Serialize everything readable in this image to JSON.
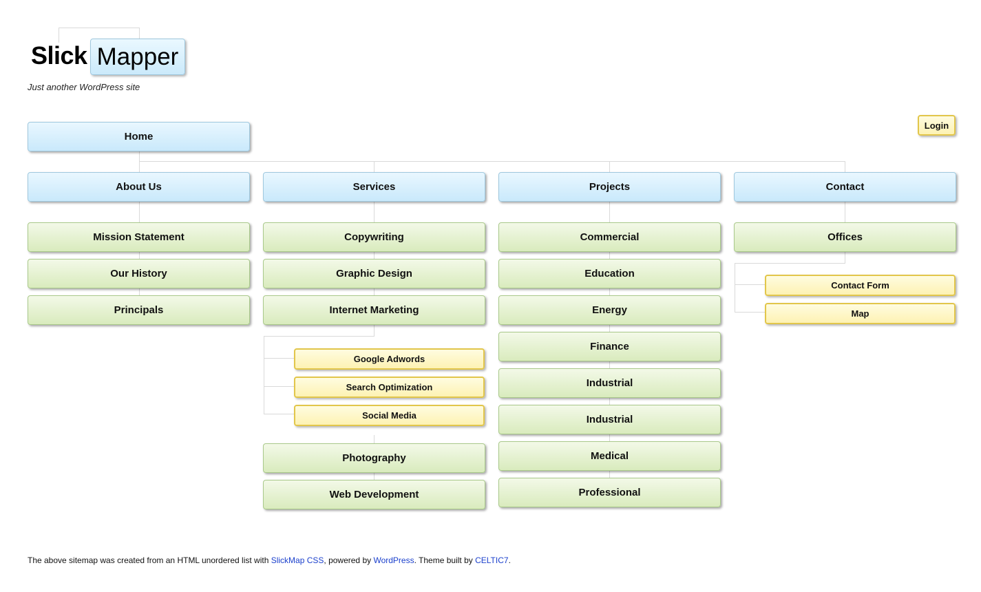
{
  "site": {
    "logo_word1": "Slick",
    "logo_word2": "Mapper",
    "tagline": "Just another WordPress site"
  },
  "utility": {
    "login_label": "Login"
  },
  "sitemap": {
    "home": "Home",
    "sections": [
      {
        "label": "About Us",
        "children": [
          "Mission Statement",
          "Our History",
          "Principals"
        ]
      },
      {
        "label": "Services",
        "children": [
          "Copywriting",
          "Graphic Design",
          "Internet Marketing",
          "Photography",
          "Web Development"
        ],
        "sub": {
          "parent": "Internet Marketing",
          "items": [
            "Google Adwords",
            "Search Optimization",
            "Social Media"
          ]
        }
      },
      {
        "label": "Projects",
        "children": [
          "Commercial",
          "Education",
          "Energy",
          "Finance",
          "Industrial",
          "Industrial",
          "Medical",
          "Professional"
        ]
      },
      {
        "label": "Contact",
        "children": [
          "Offices"
        ],
        "sub": {
          "parent": "Offices",
          "items": [
            "Contact Form",
            "Map"
          ]
        }
      }
    ]
  },
  "footer": {
    "text1": "The above sitemap was created from an HTML unordered list with ",
    "link1": "SlickMap CSS",
    "text2": ", powered by ",
    "link2": "WordPress",
    "text3": ". Theme built by ",
    "link3": "CELTIC7",
    "text4": "."
  },
  "colors": {
    "level1": "#d6effc",
    "level2": "#e4f1d0",
    "level3": "#fdf6c6",
    "connector": "#d9d9d9",
    "link": "#1a3fcc"
  }
}
